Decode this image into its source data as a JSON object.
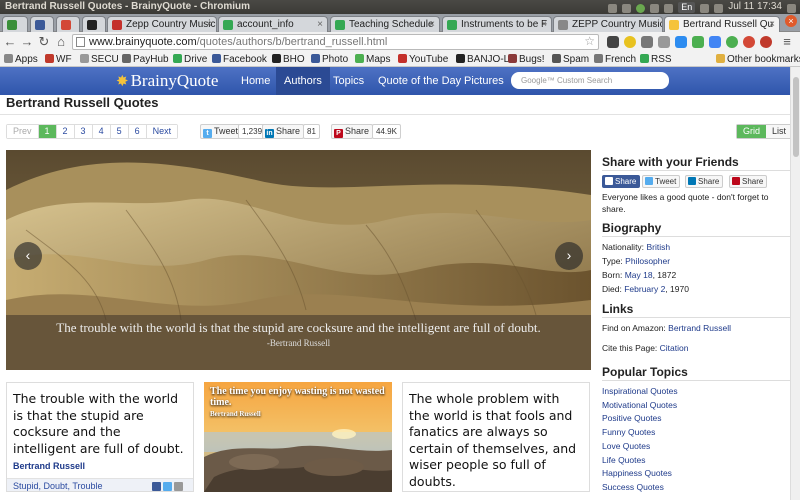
{
  "os": {
    "title": "Bertrand Russell Quotes - BrainyQuote - Chromium",
    "lang": "En",
    "clock": "Jul 11 17:34"
  },
  "tabs": [
    {
      "label": ""
    },
    {
      "label": ""
    },
    {
      "label": ""
    },
    {
      "label": ""
    },
    {
      "label": "Zepp Country Music"
    },
    {
      "label": "account_info"
    },
    {
      "label": "Teaching Schedule"
    },
    {
      "label": "Instruments to be F"
    },
    {
      "label": "ZEPP Country Music"
    },
    {
      "label": "Bertrand Russell Qu"
    }
  ],
  "browser": {
    "url_host": "www.brainyquote.com",
    "url_path": "/quotes/authors/b/bertrand_russell.html"
  },
  "bookmarks": [
    "Apps",
    "WF",
    "SECU",
    "PayHub",
    "Drive",
    "Facebook",
    "BHO",
    "Photo",
    "Maps",
    "YouTube",
    "BANJO-L",
    "Bugs!",
    "Spam",
    "French",
    "RSS",
    "Other bookmarks"
  ],
  "site": {
    "logo": "BrainyQuote",
    "nav": [
      "Home",
      "Authors",
      "Topics",
      "Quote of the Day",
      "Pictures"
    ],
    "search_placeholder": "Google™ Custom Search"
  },
  "page": {
    "title": "Bertrand Russell Quotes",
    "pager": [
      "Prev",
      "1",
      "2",
      "3",
      "4",
      "5",
      "6",
      "Next"
    ],
    "tweet_label": "Tweet",
    "tweet_count": "1,239",
    "li_label": "Share",
    "li_count": "81",
    "pin_label": "Share",
    "pin_count": "44.9K",
    "view_grid": "Grid",
    "view_list": "List"
  },
  "hero": {
    "quote": "The trouble with the world is that the stupid are cocksure and the intelligent are full of doubt.",
    "author": "-Bertrand Russell"
  },
  "cards": {
    "card1_quote": "The trouble with the world is that the stupid are cocksure and the intelligent are full of doubt.",
    "card1_author": "Bertrand Russell",
    "card1_tags": "Stupid, Doubt, Trouble",
    "img_quote": "The time you enjoy wasting is not wasted time.",
    "img_author": "Bertrand Russell",
    "card3_quote": "The whole problem with the world is that fools and fanatics are always so certain of themselves, and wiser people so full of doubts."
  },
  "sidebar": {
    "share_heading": "Share with your Friends",
    "share_buttons": [
      "Share",
      "Tweet",
      "Share",
      "Share"
    ],
    "share_text": "Everyone likes a good quote - don't forget to share.",
    "bio_heading": "Biography",
    "nationality_label": "Nationality:",
    "nationality": "British",
    "type_label": "Type:",
    "type": "Philosopher",
    "born_label": "Born:",
    "born_link": "May 18",
    "born_year": ", 1872",
    "died_label": "Died:",
    "died_link": "February 2",
    "died_year": ", 1970",
    "links_heading": "Links",
    "amazon_label": "Find on Amazon:",
    "amazon_link": "Bertrand Russell",
    "cite_label": "Cite this Page:",
    "cite_link": "Citation",
    "topics_heading": "Popular Topics",
    "topics": [
      "Inspirational Quotes",
      "Motivational Quotes",
      "Positive Quotes",
      "Funny Quotes",
      "Love Quotes",
      "Life Quotes",
      "Happiness Quotes",
      "Success Quotes"
    ]
  },
  "colors": {
    "header_blue": "#3b62b8",
    "active_green": "#5cb85c",
    "link_blue": "#1e3a8a"
  }
}
